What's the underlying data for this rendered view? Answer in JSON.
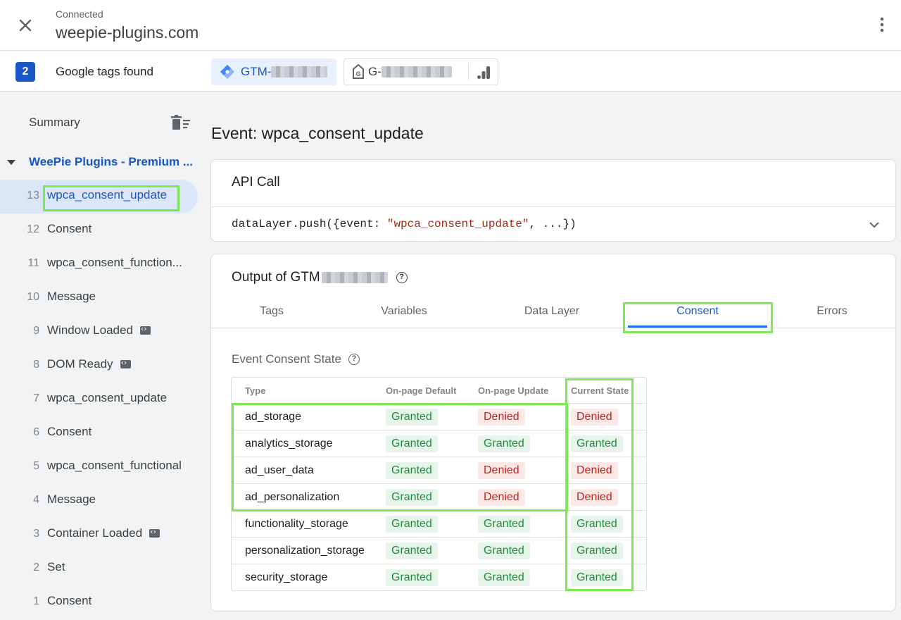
{
  "header": {
    "status_label": "Connected",
    "domain": "weepie-plugins.com"
  },
  "tags_bar": {
    "count": "2",
    "label": "Google tags found",
    "gtm_chip_prefix": "GTM-",
    "ga_chip_prefix": "G-"
  },
  "sidebar": {
    "summary_label": "Summary",
    "group_title": "WeePie Plugins - Premium ...",
    "events": [
      {
        "num": "13",
        "name": "wpca_consent_update",
        "active": true
      },
      {
        "num": "12",
        "name": "Consent"
      },
      {
        "num": "11",
        "name": "wpca_consent_function..."
      },
      {
        "num": "10",
        "name": "Message"
      },
      {
        "num": "9",
        "name": "Window Loaded",
        "badge": true
      },
      {
        "num": "8",
        "name": "DOM Ready",
        "badge": true
      },
      {
        "num": "7",
        "name": "wpca_consent_update"
      },
      {
        "num": "6",
        "name": "Consent"
      },
      {
        "num": "5",
        "name": "wpca_consent_functional"
      },
      {
        "num": "4",
        "name": "Message"
      },
      {
        "num": "3",
        "name": "Container Loaded",
        "badge": true
      },
      {
        "num": "2",
        "name": "Set"
      },
      {
        "num": "1",
        "name": "Consent"
      }
    ]
  },
  "main": {
    "event_title": "Event: wpca_consent_update",
    "api_call": {
      "header": "API Call",
      "code_prefix": "dataLayer.push({event: ",
      "code_string": "\"wpca_consent_update\"",
      "code_suffix": ", ...})"
    },
    "output": {
      "title_prefix": "Output of GTM",
      "tabs": [
        "Tags",
        "Variables",
        "Data Layer",
        "Consent",
        "Errors"
      ],
      "active_tab": "Consent",
      "consent_state_header": "Event Consent State",
      "columns": [
        "Type",
        "On-page Default",
        "On-page Update",
        "Current State"
      ],
      "rows": [
        {
          "type": "ad_storage",
          "default": "Granted",
          "update": "Denied",
          "current": "Denied"
        },
        {
          "type": "analytics_storage",
          "default": "Granted",
          "update": "Granted",
          "current": "Granted"
        },
        {
          "type": "ad_user_data",
          "default": "Granted",
          "update": "Denied",
          "current": "Denied"
        },
        {
          "type": "ad_personalization",
          "default": "Granted",
          "update": "Denied",
          "current": "Denied"
        },
        {
          "type": "functionality_storage",
          "default": "Granted",
          "update": "Granted",
          "current": "Granted"
        },
        {
          "type": "personalization_storage",
          "default": "Granted",
          "update": "Granted",
          "current": "Granted"
        },
        {
          "type": "security_storage",
          "default": "Granted",
          "update": "Granted",
          "current": "Granted"
        }
      ]
    }
  },
  "colors": {
    "accent": "#1a57c6",
    "highlight": "#7bea55",
    "granted_bg": "#e6f4ea",
    "granted_text": "#1e8e3e",
    "denied_bg": "#fce8e6",
    "denied_text": "#c5221f"
  },
  "icons": [
    "close-icon",
    "more-vert-icon",
    "gtm-diamond-icon",
    "google-tag-icon",
    "analytics-icon",
    "delete-sweep-icon",
    "expand-more-icon",
    "help-icon",
    "code-icon"
  ]
}
